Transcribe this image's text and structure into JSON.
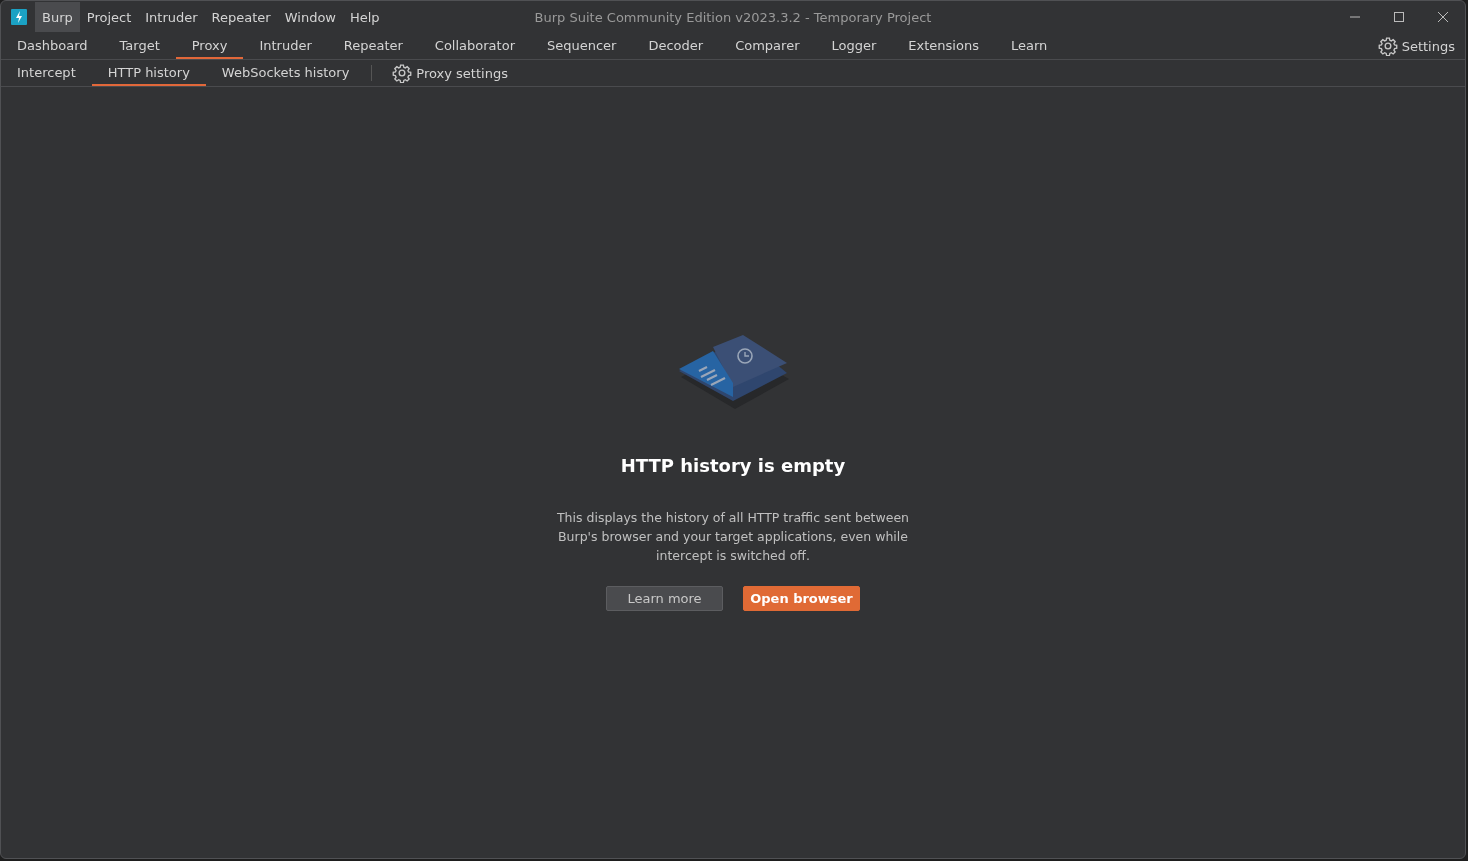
{
  "window": {
    "title": "Burp Suite Community Edition v2023.3.2 - Temporary Project"
  },
  "menu": [
    {
      "label": "Burp",
      "selected": true
    },
    {
      "label": "Project",
      "selected": false
    },
    {
      "label": "Intruder",
      "selected": false
    },
    {
      "label": "Repeater",
      "selected": false
    },
    {
      "label": "Window",
      "selected": false
    },
    {
      "label": "Help",
      "selected": false
    }
  ],
  "tabs": [
    {
      "label": "Dashboard",
      "selected": false
    },
    {
      "label": "Target",
      "selected": false
    },
    {
      "label": "Proxy",
      "selected": true
    },
    {
      "label": "Intruder",
      "selected": false
    },
    {
      "label": "Repeater",
      "selected": false
    },
    {
      "label": "Collaborator",
      "selected": false
    },
    {
      "label": "Sequencer",
      "selected": false
    },
    {
      "label": "Decoder",
      "selected": false
    },
    {
      "label": "Comparer",
      "selected": false
    },
    {
      "label": "Logger",
      "selected": false
    },
    {
      "label": "Extensions",
      "selected": false
    },
    {
      "label": "Learn",
      "selected": false
    }
  ],
  "settings_button": "Settings",
  "subtabs": [
    {
      "label": "Intercept",
      "selected": false
    },
    {
      "label": "HTTP history",
      "selected": true
    },
    {
      "label": "WebSockets history",
      "selected": false
    }
  ],
  "proxy_settings": "Proxy settings",
  "empty_state": {
    "title": "HTTP history is empty",
    "description": "This displays the history of all HTTP traffic sent between Burp's browser and your target applications, even while intercept is switched off.",
    "buttons": [
      {
        "label": "Learn more",
        "kind": "secondary"
      },
      {
        "label": "Open browser",
        "kind": "primary"
      }
    ]
  }
}
